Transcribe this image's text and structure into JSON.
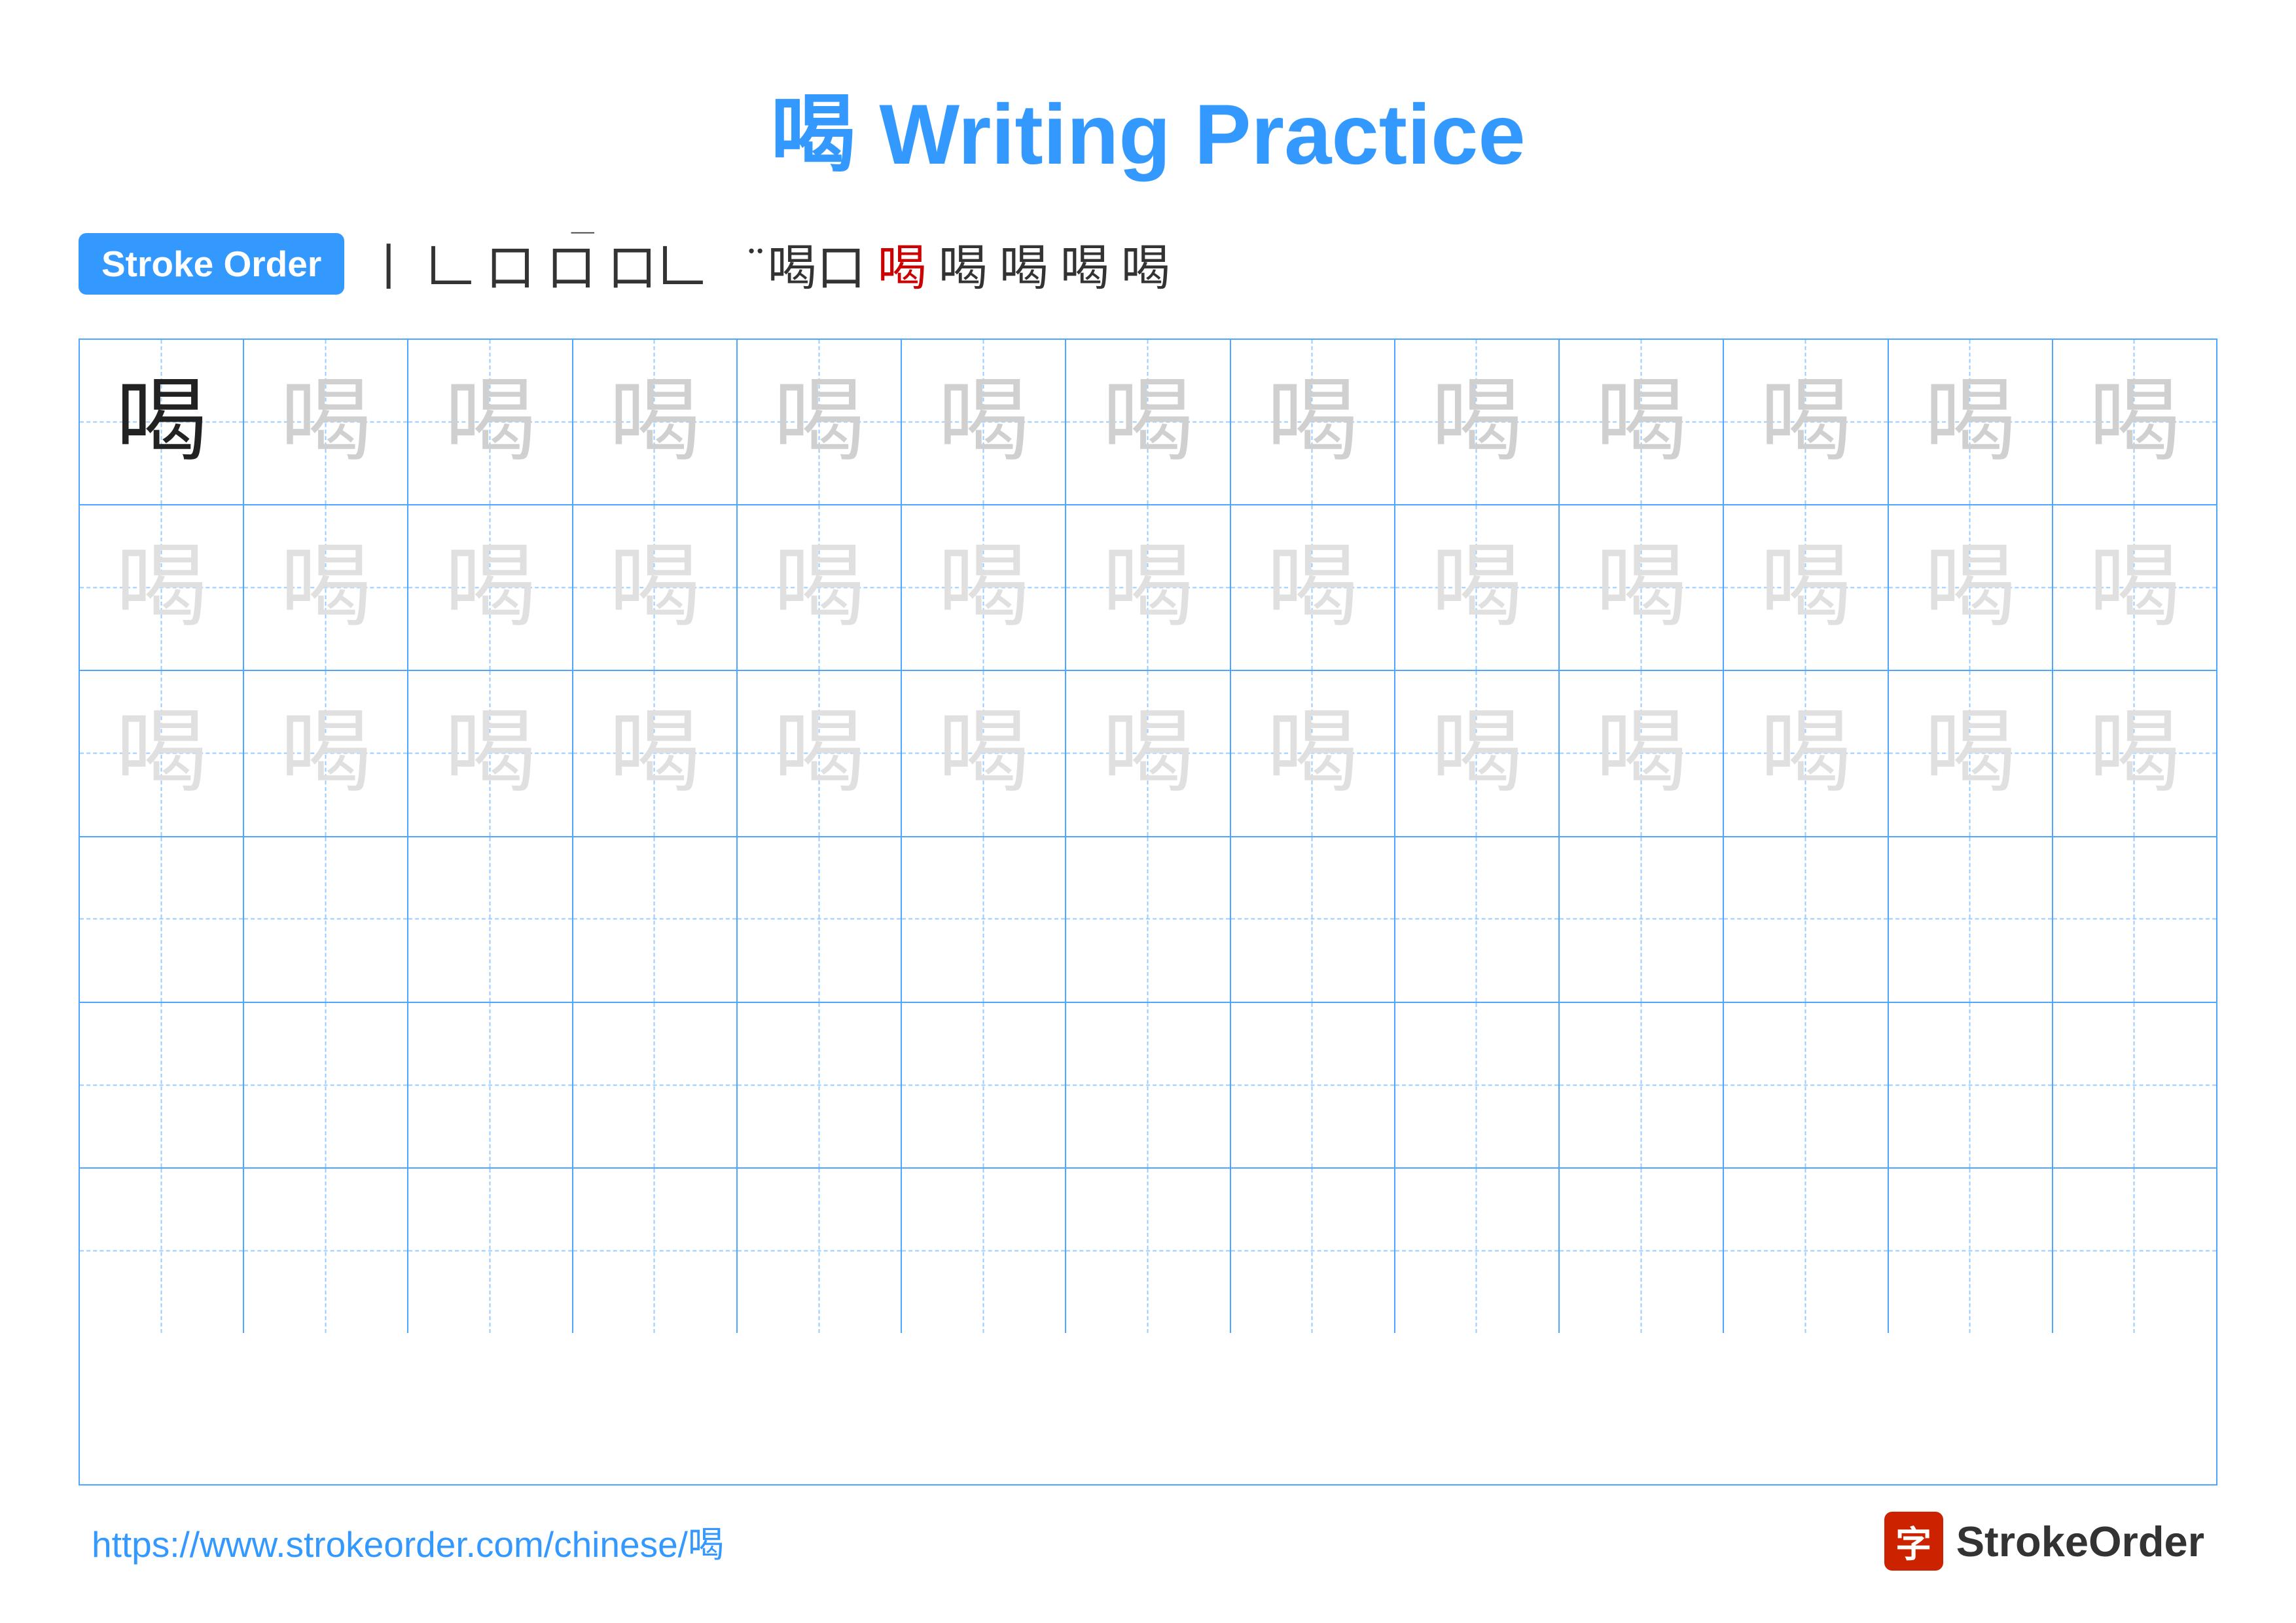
{
  "title": "喝 Writing Practice",
  "stroke_order": {
    "badge_label": "Stroke Order",
    "strokes": [
      "㇒",
      "𠃊",
      "口",
      "口¯",
      "口𠃊",
      "喝̄",
      "喝口",
      "喝𠃊",
      "喝",
      "喝",
      "喝",
      "喝",
      "喝"
    ]
  },
  "character": "喝",
  "grid": {
    "cols": 13,
    "rows": 6
  },
  "footer": {
    "url": "https://www.strokeorder.com/chinese/喝",
    "logo_text": "StrokeOrder",
    "logo_char": "字"
  }
}
